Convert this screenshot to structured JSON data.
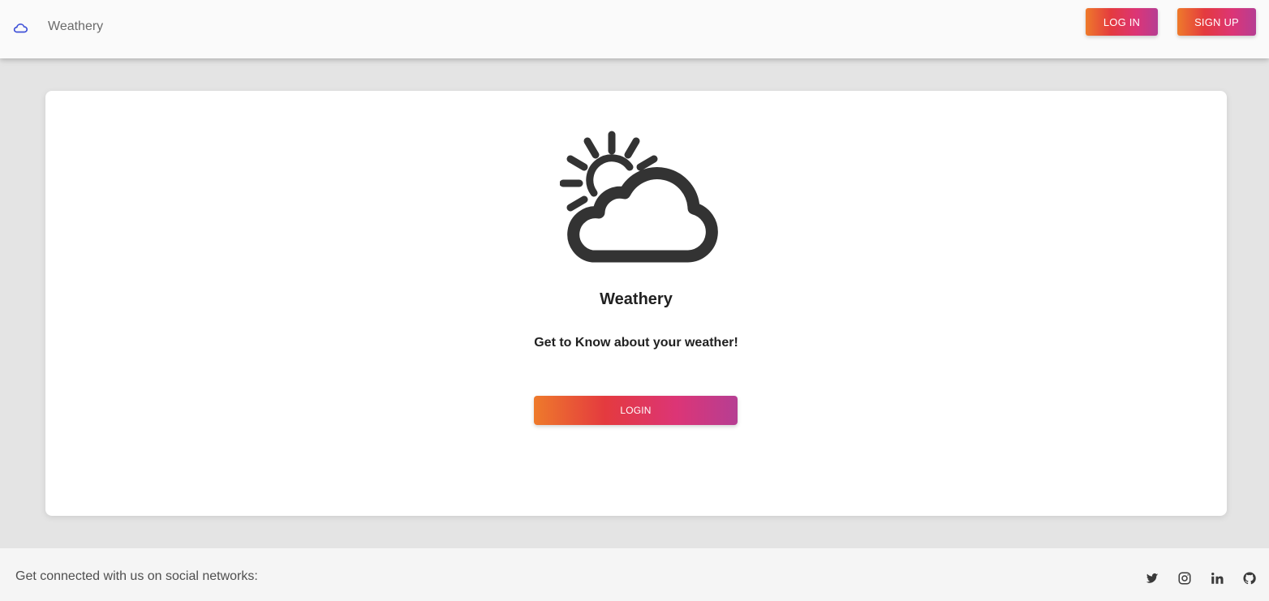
{
  "navbar": {
    "logo_icon": "cloud-icon",
    "brand": "Weathery",
    "login_label": "LOG IN",
    "signup_label": "SIGN UP"
  },
  "hero": {
    "icon": "partly-cloudy-icon",
    "title": "Weathery",
    "subtitle": "Get to Know about your weather!",
    "button_label": "LOGIN"
  },
  "footer": {
    "text": "Get connected with us on social networks:",
    "social_icons": [
      "twitter-icon",
      "instagram-icon",
      "linkedin-icon",
      "github-icon"
    ]
  },
  "colors": {
    "gradient_start": "#ee7a2b",
    "gradient_mid": "#e43a3f",
    "gradient_end": "#b63e93",
    "logo_blue": "#3f51d8",
    "icon_dark": "#333333"
  }
}
